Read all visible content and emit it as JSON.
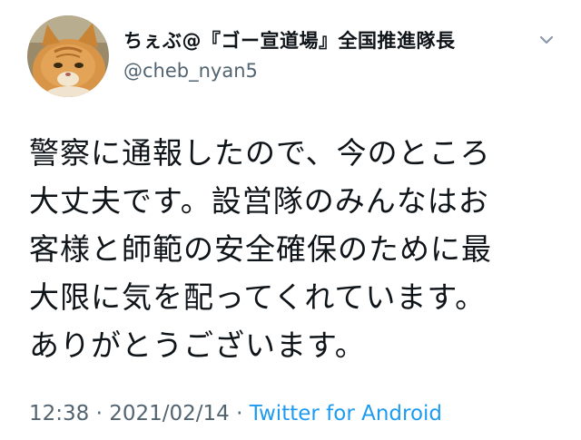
{
  "author": {
    "display_name": "ちぇぶ@『ゴー宣道場』全国推進隊長",
    "handle": "@cheb_nyan5",
    "avatar_icon": "orange-cat-avatar"
  },
  "menu": {
    "icon": "chevron-down-icon"
  },
  "tweet": {
    "lines": [
      "警察に通報したので、今のところ",
      "大丈夫です。設営隊のみんなはお",
      "客様と師範の安全確保のために最",
      "大限に気を配ってくれています。",
      "ありがとうございます。"
    ]
  },
  "meta": {
    "time": "12:38",
    "separator1": " · ",
    "date": "2021/02/14",
    "separator2": " · ",
    "source": "Twitter for Android"
  },
  "colors": {
    "text": "#0f1419",
    "secondary": "#536471",
    "link": "#1d9bf0"
  }
}
